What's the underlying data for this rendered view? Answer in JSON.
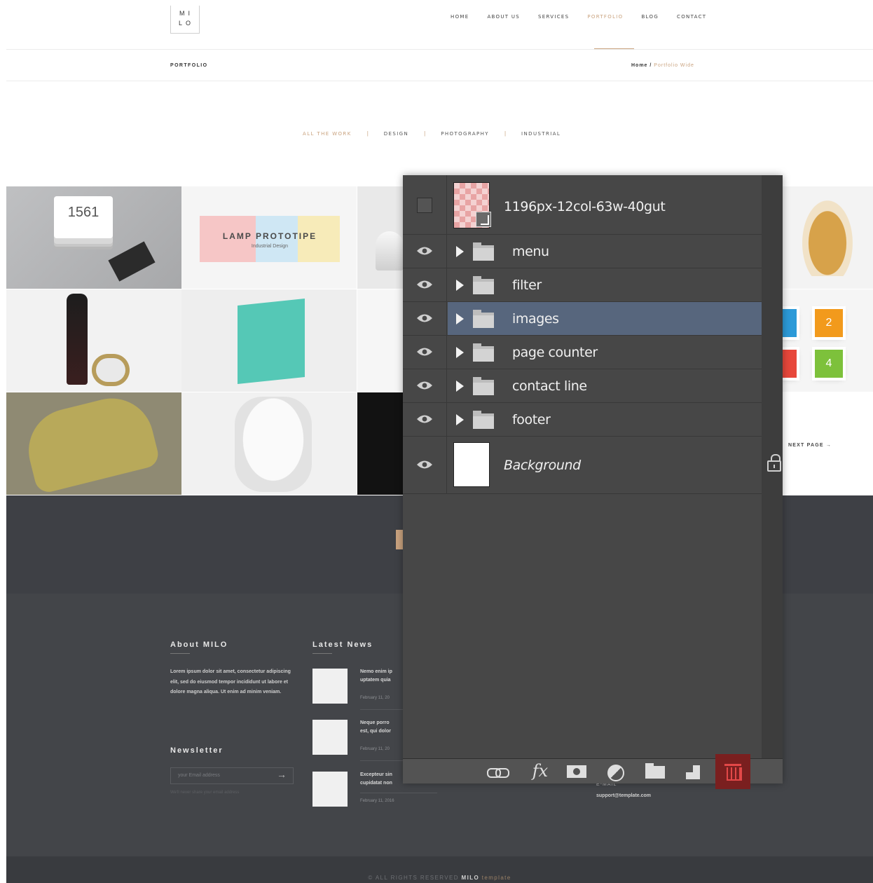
{
  "site": {
    "logo_text": "MI LO",
    "nav": [
      "HOME",
      "ABOUT US",
      "SERVICES",
      "PORTFOLIO",
      "BLOG",
      "CONTACT"
    ],
    "active_nav": "PORTFOLIO",
    "page_title": "PORTFOLIO",
    "breadcrumb_home": "Home",
    "breadcrumb_sep": " / ",
    "breadcrumb_current": "Portfolio Wide",
    "filters": [
      "ALL THE WORK",
      "DESIGN",
      "PHOTOGRAPHY",
      "INDUSTRIAL"
    ],
    "filter_sep": "|",
    "tiles": {
      "card_number": "1561",
      "lamp_title": "LAMP PROTOTIPE",
      "lamp_subtitle": "Industrial Design",
      "num_2": "2",
      "num_4": "4",
      "next_page": "NEXT PAGE →"
    },
    "footer": {
      "about_heading": "About MILO",
      "about_text": "Lorem ipsum dolor sit amet, consectetur adipiscing elit, sed do eiusmod tempor incididunt ut labore et dolore magna aliqua. Ut enim ad minim veniam.",
      "news_heading": "Latest News",
      "news": [
        {
          "title_l1": "Nemo enim ip",
          "title_l2": "uptatem quia",
          "date": "February 11, 20"
        },
        {
          "title_l1": "Neque porro",
          "title_l2": "est, qui dolor",
          "date": "February 11, 20"
        },
        {
          "title_l1": "Excepteur sin",
          "title_l2": "cupidatat non",
          "date": "February 11, 2016"
        }
      ],
      "newsletter_heading": "Newsletter",
      "newsletter_placeholder": "your Email address",
      "newsletter_note": "We'll never share your email address",
      "email_label": "E-MAIL",
      "email_value": "support@template.com",
      "copyright_prefix": "© ALL RIGHTS RESERVED",
      "copyright_brand": "MILO",
      "copyright_suffix": "template"
    }
  },
  "layers_panel": {
    "layers": [
      {
        "name": "1196px-12col-63w-40gut",
        "type": "smart-object",
        "visible": false
      },
      {
        "name": "menu",
        "type": "group",
        "visible": true
      },
      {
        "name": "filter",
        "type": "group",
        "visible": true
      },
      {
        "name": "images",
        "type": "group",
        "visible": true,
        "selected": true
      },
      {
        "name": "page counter",
        "type": "group",
        "visible": true
      },
      {
        "name": "contact line",
        "type": "group",
        "visible": true
      },
      {
        "name": "footer",
        "type": "group",
        "visible": true
      },
      {
        "name": "Background",
        "type": "background",
        "visible": true,
        "locked": true
      }
    ],
    "toolbar": {
      "fx_label": "fx"
    }
  },
  "colors": {
    "accent_gold": "#c9a27e",
    "panel_bg": "#474747",
    "selected_row": "#57667d",
    "delete_highlight": "#7a1f1f",
    "footer_bg": "#434549"
  }
}
